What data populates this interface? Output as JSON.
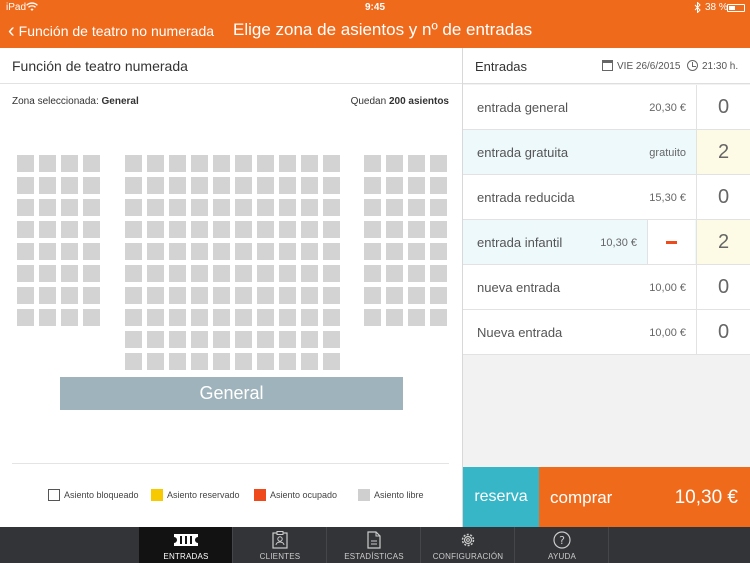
{
  "status_bar": {
    "carrier": "iPad",
    "time": "9:45",
    "battery": "38 %"
  },
  "header": {
    "back_label": "Función de teatro no numerada",
    "title": "Elige zona de asientos y nº de entradas"
  },
  "left": {
    "title": "Función de teatro numerada",
    "zona_label": "Zona seleccionada: ",
    "zona_value": "General",
    "quedan_label": "Quedan ",
    "quedan_value": "200 asientos",
    "stage_label": "General",
    "seat_blocks": [
      {
        "cols": 4,
        "rows": 8
      },
      {
        "cols": 10,
        "rows": 10
      },
      {
        "cols": 4,
        "rows": 8
      }
    ],
    "legend": [
      {
        "label": "Asiento bloqueado",
        "color": "#ffffff",
        "border": "#555555"
      },
      {
        "label": "Asiento reservado",
        "color": "#f7c900",
        "border": "#f7c900"
      },
      {
        "label": "Asiento ocupado",
        "color": "#ef4a1b",
        "border": "#ef4a1b"
      },
      {
        "label": "Asiento libre",
        "color": "#cfcfcf",
        "border": "#cfcfcf"
      }
    ]
  },
  "right": {
    "title": "Entradas",
    "date": "VIE 26/6/2015",
    "time": "21:30 h.",
    "tickets": [
      {
        "name": "entrada general",
        "price": "20,30 €",
        "count": "0"
      },
      {
        "name": "entrada gratuita",
        "price": "gratuito",
        "count": "2"
      },
      {
        "name": "entrada reducida",
        "price": "15,30 €",
        "count": "0"
      },
      {
        "name": "entrada infantil",
        "price": "10,30 €",
        "count": "2"
      },
      {
        "name": "nueva entrada",
        "price": "10,00 €",
        "count": "0"
      },
      {
        "name": "Nueva entrada",
        "price": "10,00 €",
        "count": "0"
      }
    ],
    "reserva_label": "reserva",
    "comprar_label": "comprar",
    "total": "10,30 €"
  },
  "tabs": [
    {
      "label": "ENTRADAS",
      "icon": "ticket-icon"
    },
    {
      "label": "CLIENTES",
      "icon": "clients-icon"
    },
    {
      "label": "ESTADÍSTICAS",
      "icon": "stats-icon"
    },
    {
      "label": "CONFIGURACIÓN",
      "icon": "gear-icon"
    },
    {
      "label": "AYUDA",
      "icon": "help-icon"
    }
  ],
  "colors": {
    "brand": "#ef6a1b",
    "reserva": "#36b6c7",
    "stage": "#9fb3bc",
    "tabbar": "#333437"
  }
}
